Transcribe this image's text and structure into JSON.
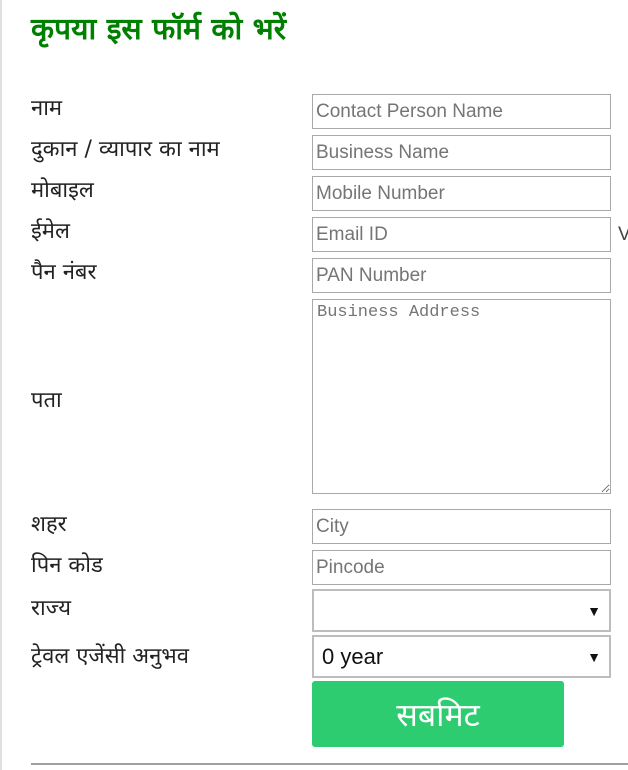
{
  "form": {
    "title": "कृपया इस फॉर्म को भरें",
    "fields": {
      "name": {
        "label": "नाम",
        "placeholder": "Contact Person Name"
      },
      "business": {
        "label": "दुकान / व्यापार का नाम",
        "placeholder": "Business Name"
      },
      "mobile": {
        "label": "मोबाइल",
        "placeholder": "Mobile Number"
      },
      "email": {
        "label": "ईमेल",
        "placeholder": "Email ID",
        "suffix": "V"
      },
      "pan": {
        "label": "पैन नंबर",
        "placeholder": "PAN Number"
      },
      "address": {
        "label": "पता",
        "placeholder": "Business Address"
      },
      "city": {
        "label": "शहर",
        "placeholder": "City"
      },
      "pincode": {
        "label": "पिन कोड",
        "placeholder": "Pincode"
      },
      "state": {
        "label": "राज्य",
        "selected": "",
        "caret": "▼"
      },
      "experience": {
        "label": "ट्रेवल एजेंसी अनुभव",
        "selected": "0 year",
        "caret": "▼"
      }
    },
    "submit_label": "सबमिट",
    "colors": {
      "title": "#008000",
      "submit_bg": "#2ecc71"
    }
  }
}
